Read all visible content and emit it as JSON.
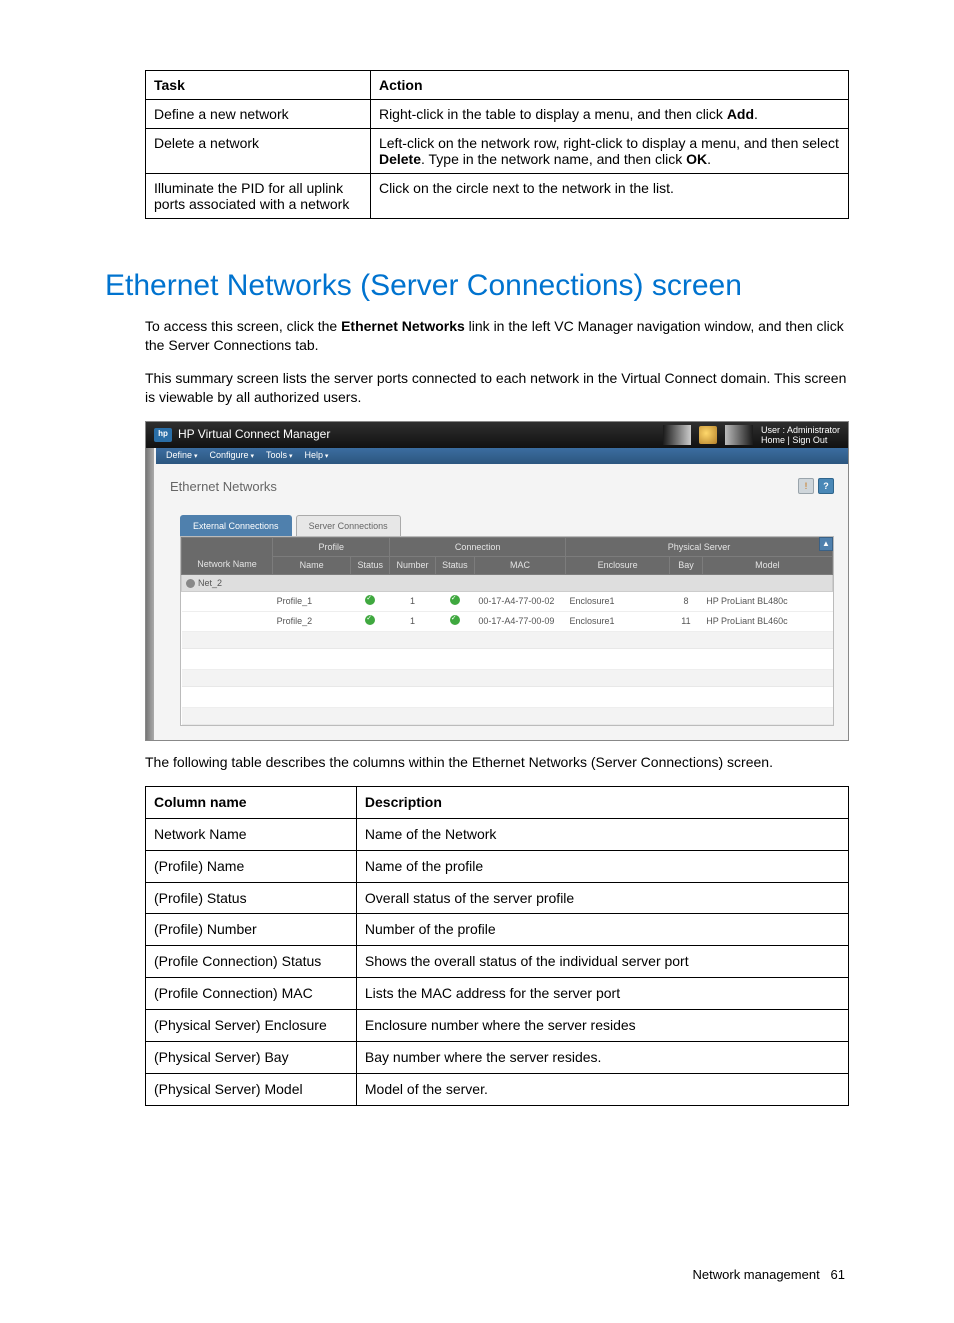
{
  "tasks_table": {
    "headers": [
      "Task",
      "Action"
    ],
    "rows": [
      {
        "task": "Define a new network",
        "action_pre": "Right-click in the table to display a menu, and then click ",
        "action_bold": "Add",
        "action_post": "."
      },
      {
        "task": "Delete a network",
        "action_pre": "Left-click on the network row, right-click to display a menu, and then select ",
        "action_bold": "Delete",
        "action_mid": ". Type in the network name, and then click ",
        "action_bold2": "OK",
        "action_post": "."
      },
      {
        "task": "Illuminate the PID for all uplink ports associated with a network",
        "action_pre": "Click on the circle next to the network in the list.",
        "action_bold": "",
        "action_post": ""
      }
    ]
  },
  "heading": "Ethernet Networks (Server Connections) screen",
  "intro": {
    "p1_pre": "To access this screen, click the ",
    "p1_bold": "Ethernet Networks",
    "p1_post": " link in the left VC Manager navigation window, and then click the Server Connections tab.",
    "p2": "This summary screen lists the server ports connected to each network in the Virtual Connect domain. This screen is viewable by all authorized users."
  },
  "app": {
    "title": "HP Virtual Connect Manager",
    "user_line1": "User : Administrator",
    "user_home": "Home",
    "user_signout": "Sign Out",
    "menu": [
      "Define",
      "Configure",
      "Tools",
      "Help"
    ],
    "page_title": "Ethernet Networks",
    "warn_icon": "!",
    "help_icon": "?",
    "tabs": {
      "external": "External Connections",
      "server": "Server Connections"
    },
    "group_headers": {
      "network": "Network Name",
      "profile": "Profile",
      "connection": "Connection",
      "physical": "Physical Server"
    },
    "col_headers": {
      "pname": "Name",
      "pstatus": "Status",
      "cnumber": "Number",
      "cstatus": "Status",
      "cmac": "MAC",
      "enclosure": "Enclosure",
      "bay": "Bay",
      "model": "Model"
    },
    "net_row": "Net_2",
    "rows": [
      {
        "pname": "Profile_1",
        "pstatus": "ok",
        "cnumber": "1",
        "cstatus": "ok",
        "cmac": "00-17-A4-77-00-02",
        "enclosure": "Enclosure1",
        "bay": "8",
        "model": "HP ProLiant BL480c"
      },
      {
        "pname": "Profile_2",
        "pstatus": "ok",
        "cnumber": "1",
        "cstatus": "ok",
        "cmac": "00-17-A4-77-00-09",
        "enclosure": "Enclosure1",
        "bay": "11",
        "model": "HP ProLiant BL460c"
      }
    ],
    "scroll_up": "▲"
  },
  "table_intro": "The following table describes the columns within the Ethernet Networks (Server Connections) screen.",
  "cols_table": {
    "headers": [
      "Column name",
      "Description"
    ],
    "rows": [
      {
        "c": "Network Name",
        "d": "Name of the Network"
      },
      {
        "c": "(Profile) Name",
        "d": "Name of the profile"
      },
      {
        "c": "(Profile) Status",
        "d": "Overall status of the server profile"
      },
      {
        "c": "(Profile) Number",
        "d": "Number of the profile"
      },
      {
        "c": "(Profile Connection) Status",
        "d": "Shows the overall status of the individual server port"
      },
      {
        "c": "(Profile Connection) MAC",
        "d": "Lists the MAC address for the server port"
      },
      {
        "c": "(Physical Server) Enclosure",
        "d": "Enclosure number where the server resides"
      },
      {
        "c": "(Physical Server) Bay",
        "d": "Bay number where the server resides."
      },
      {
        "c": "(Physical Server) Model",
        "d": "Model of the server."
      }
    ]
  },
  "footer": {
    "section": "Network management",
    "page": "61"
  }
}
